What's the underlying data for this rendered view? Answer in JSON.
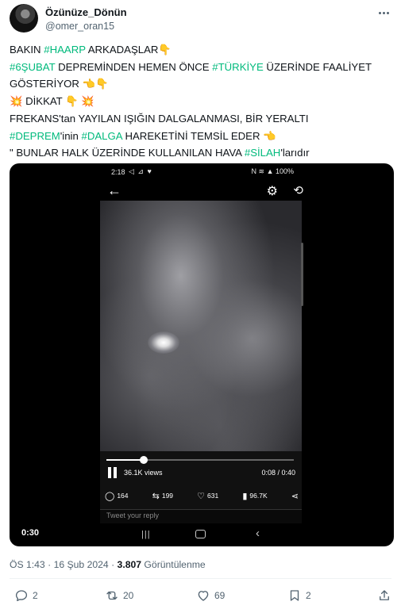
{
  "author": {
    "display_name": "Özünüze_Dönün",
    "handle": "@omer_oran15"
  },
  "tweet": {
    "lines": [
      [
        {
          "t": "BAKIN "
        },
        {
          "t": "#HAARP",
          "tag": true
        },
        {
          "t": " ARKADAŞLAR👇"
        }
      ],
      [
        {
          "t": "#6ŞUBAT",
          "tag": true
        },
        {
          "t": " DEPREMİNDEN HEMEN ÖNCE "
        },
        {
          "t": "#TÜRKİYE",
          "tag": true
        },
        {
          "t": " ÜZERİNDE FAALİYET"
        }
      ],
      [
        {
          "t": "GÖSTERİYOR 👈👇"
        }
      ],
      [
        {
          "t": "💥 DİKKAT 👇 💥"
        }
      ],
      [
        {
          "t": "FREKANS'tan YAYILAN IŞIĞIN DALGALANMASI, BİR YERALTI"
        }
      ],
      [
        {
          "t": "#DEPREM",
          "tag": true
        },
        {
          "t": "'inin "
        },
        {
          "t": "#DALGA",
          "tag": true
        },
        {
          "t": " HAREKETİNİ TEMSİL EDER 👈"
        }
      ],
      [
        {
          "t": "\" BUNLAR HALK ÜZERİNDE KULLANILAN HAVA "
        },
        {
          "t": "#SİLAH",
          "tag": true
        },
        {
          "t": "'larıdır"
        }
      ]
    ]
  },
  "video": {
    "phone_time": "2:18",
    "phone_status_icons": "N ≋ ▲ 100%",
    "progress": 0.2,
    "views": "36.1K views",
    "duration": "0:08 / 0:40",
    "stats": {
      "replies": "164",
      "reposts": "199",
      "likes": "631",
      "views": "96.7K"
    },
    "reply_placeholder": "Tweet your reply",
    "timer": "0:30"
  },
  "meta": {
    "time": "ÖS 1:43",
    "sep1": " · ",
    "date": "16 Şub 2024",
    "sep2": " · ",
    "views_count": "3.807",
    "views_label": " Görüntülenme"
  },
  "actions": {
    "replies": "2",
    "reposts": "20",
    "likes": "69",
    "bookmarks": "2"
  },
  "colors": {
    "hashtag": "#00ba7c",
    "text": "#0f1419",
    "muted": "#536471"
  }
}
